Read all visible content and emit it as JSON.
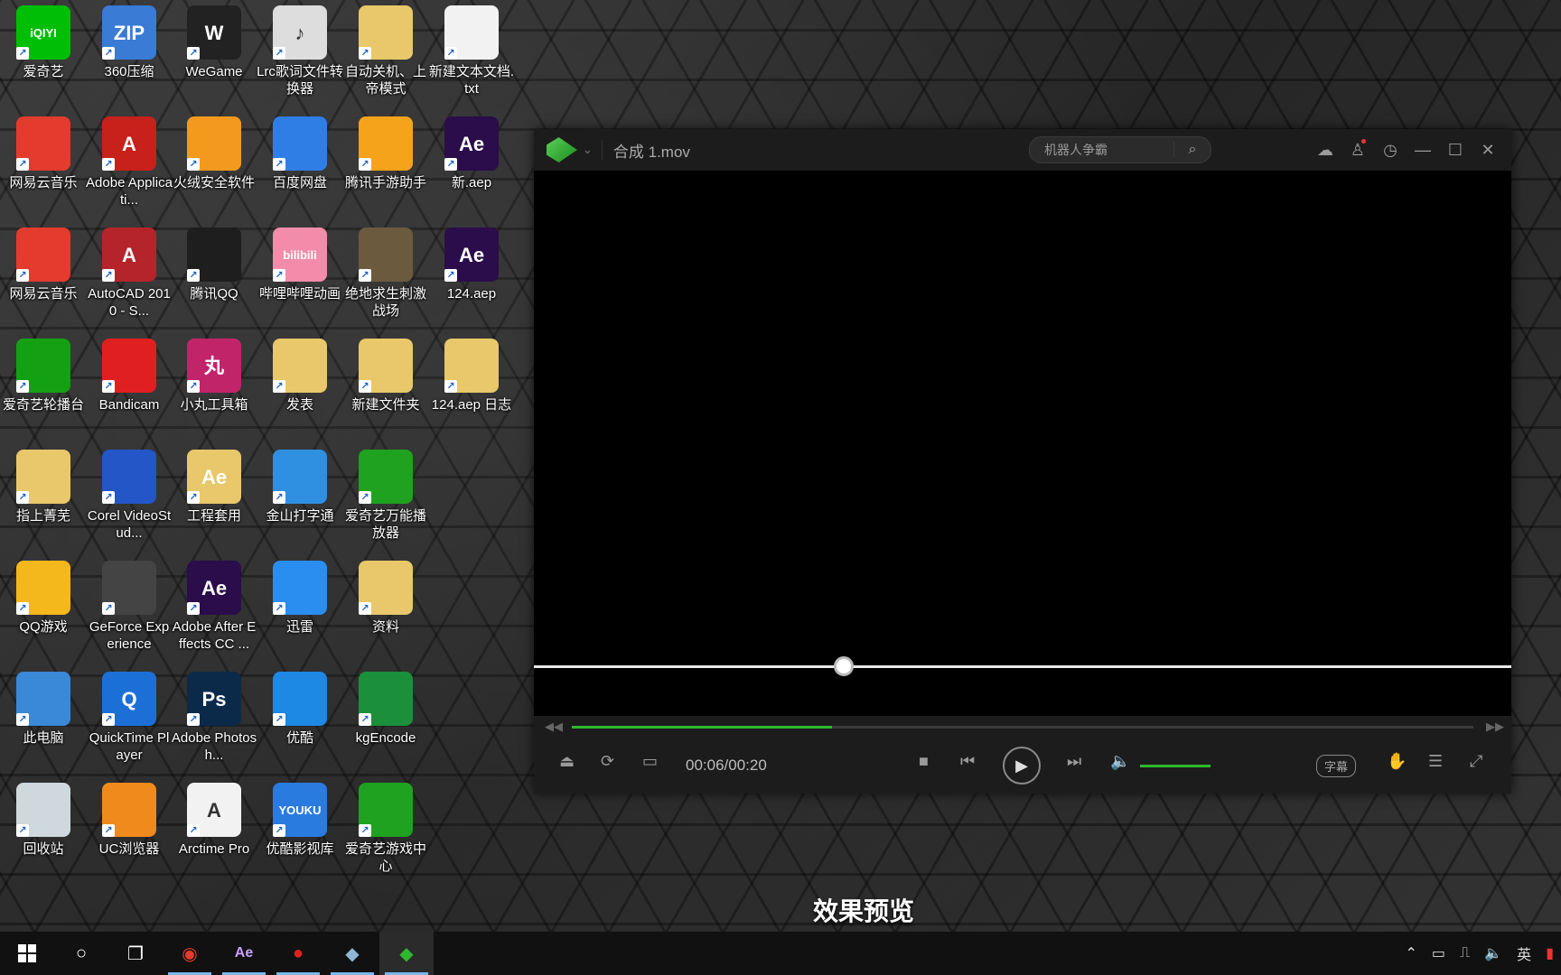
{
  "desktop": {
    "icons": [
      {
        "label": "爱奇艺",
        "badge": "iQIYI",
        "color": "#00be06"
      },
      {
        "label": "360压缩",
        "badge": "ZIP",
        "color": "#3a7bd5"
      },
      {
        "label": "WeGame",
        "badge": "W",
        "color": "#222222"
      },
      {
        "label": "Lrc歌词文件转换器",
        "badge": "♪",
        "color": "#dddddd"
      },
      {
        "label": "自动关机、上帝模式",
        "badge": "",
        "color": "#e8c86a"
      },
      {
        "label": "新建文本文档.txt",
        "badge": "",
        "color": "#f2f2f2"
      },
      {
        "label": "网易云音乐",
        "badge": "",
        "color": "#e33b2e"
      },
      {
        "label": "Adobe Applicati...",
        "badge": "A",
        "color": "#c8201a"
      },
      {
        "label": "火绒安全软件",
        "badge": "",
        "color": "#f39a1e"
      },
      {
        "label": "百度网盘",
        "badge": "",
        "color": "#2f7ee6"
      },
      {
        "label": "腾讯手游助手",
        "badge": "",
        "color": "#f6a31c"
      },
      {
        "label": "新.aep",
        "badge": "Ae",
        "color": "#2a0d4a"
      },
      {
        "label": "网易云音乐",
        "badge": "",
        "color": "#e33b2e"
      },
      {
        "label": "AutoCAD 2010 - S...",
        "badge": "A",
        "color": "#b5242a"
      },
      {
        "label": "腾讯QQ",
        "badge": "",
        "color": "#1e1e1e"
      },
      {
        "label": "哔哩哔哩动画",
        "badge": "bilibili",
        "color": "#f28caa"
      },
      {
        "label": "绝地求生刺激战场",
        "badge": "",
        "color": "#6b5a3e"
      },
      {
        "label": "124.aep",
        "badge": "Ae",
        "color": "#2a0d4a"
      },
      {
        "label": "爱奇艺轮播台",
        "badge": "",
        "color": "#13a013"
      },
      {
        "label": "Bandicam",
        "badge": "",
        "color": "#e02020"
      },
      {
        "label": "小丸工具箱",
        "badge": "丸",
        "color": "#c2246a"
      },
      {
        "label": "发表",
        "badge": "",
        "color": "#e8c86a"
      },
      {
        "label": "新建文件夹",
        "badge": "",
        "color": "#e8c86a"
      },
      {
        "label": "124.aep 日志",
        "badge": "",
        "color": "#e8c86a"
      },
      {
        "label": "指上菁芜",
        "badge": "",
        "color": "#e8c86a"
      },
      {
        "label": "Corel VideoStud...",
        "badge": "",
        "color": "#2456c8"
      },
      {
        "label": "工程套用",
        "badge": "Ae",
        "color": "#e8c86a"
      },
      {
        "label": "金山打字通",
        "badge": "",
        "color": "#2f8fe0"
      },
      {
        "label": "爱奇艺万能播放器",
        "badge": "",
        "color": "#1fa21f"
      },
      {
        "label": "QQ游戏",
        "badge": "",
        "color": "#f5b81c"
      },
      {
        "label": "GeForce Experience",
        "badge": "",
        "color": "#444444"
      },
      {
        "label": "Adobe After Effects CC ...",
        "badge": "Ae",
        "color": "#2a0d4a"
      },
      {
        "label": "迅雷",
        "badge": "",
        "color": "#2a8ef0"
      },
      {
        "label": "资料",
        "badge": "",
        "color": "#e8c86a"
      },
      {
        "label": "此电脑",
        "badge": "",
        "color": "#3a88d8"
      },
      {
        "label": "QuickTime Player",
        "badge": "Q",
        "color": "#1d6fd8"
      },
      {
        "label": "Adobe Photosh...",
        "badge": "Ps",
        "color": "#0b2a4a"
      },
      {
        "label": "优酷",
        "badge": "",
        "color": "#1e88e5"
      },
      {
        "label": "kgEncode",
        "badge": "",
        "color": "#1b8f3a"
      },
      {
        "label": "回收站",
        "badge": "",
        "color": "#cfd8dc"
      },
      {
        "label": "UC浏览器",
        "badge": "",
        "color": "#f08a1c"
      },
      {
        "label": "Arctime Pro",
        "badge": "A",
        "color": "#f2f2f2"
      },
      {
        "label": "优酷影视库",
        "badge": "YOUKU",
        "color": "#2a7be0"
      },
      {
        "label": "爱奇艺游戏中心",
        "badge": "",
        "color": "#1fa21f"
      }
    ]
  },
  "player": {
    "title": "合成 1.mov",
    "search_placeholder": "机器人争霸",
    "time": "00:06/00:20",
    "progress": 0.289,
    "volume": 0.6,
    "subtitle_label": "字幕",
    "accent": "#2eb82e"
  },
  "caption": "效果预览",
  "tray": {
    "ime": "英"
  }
}
